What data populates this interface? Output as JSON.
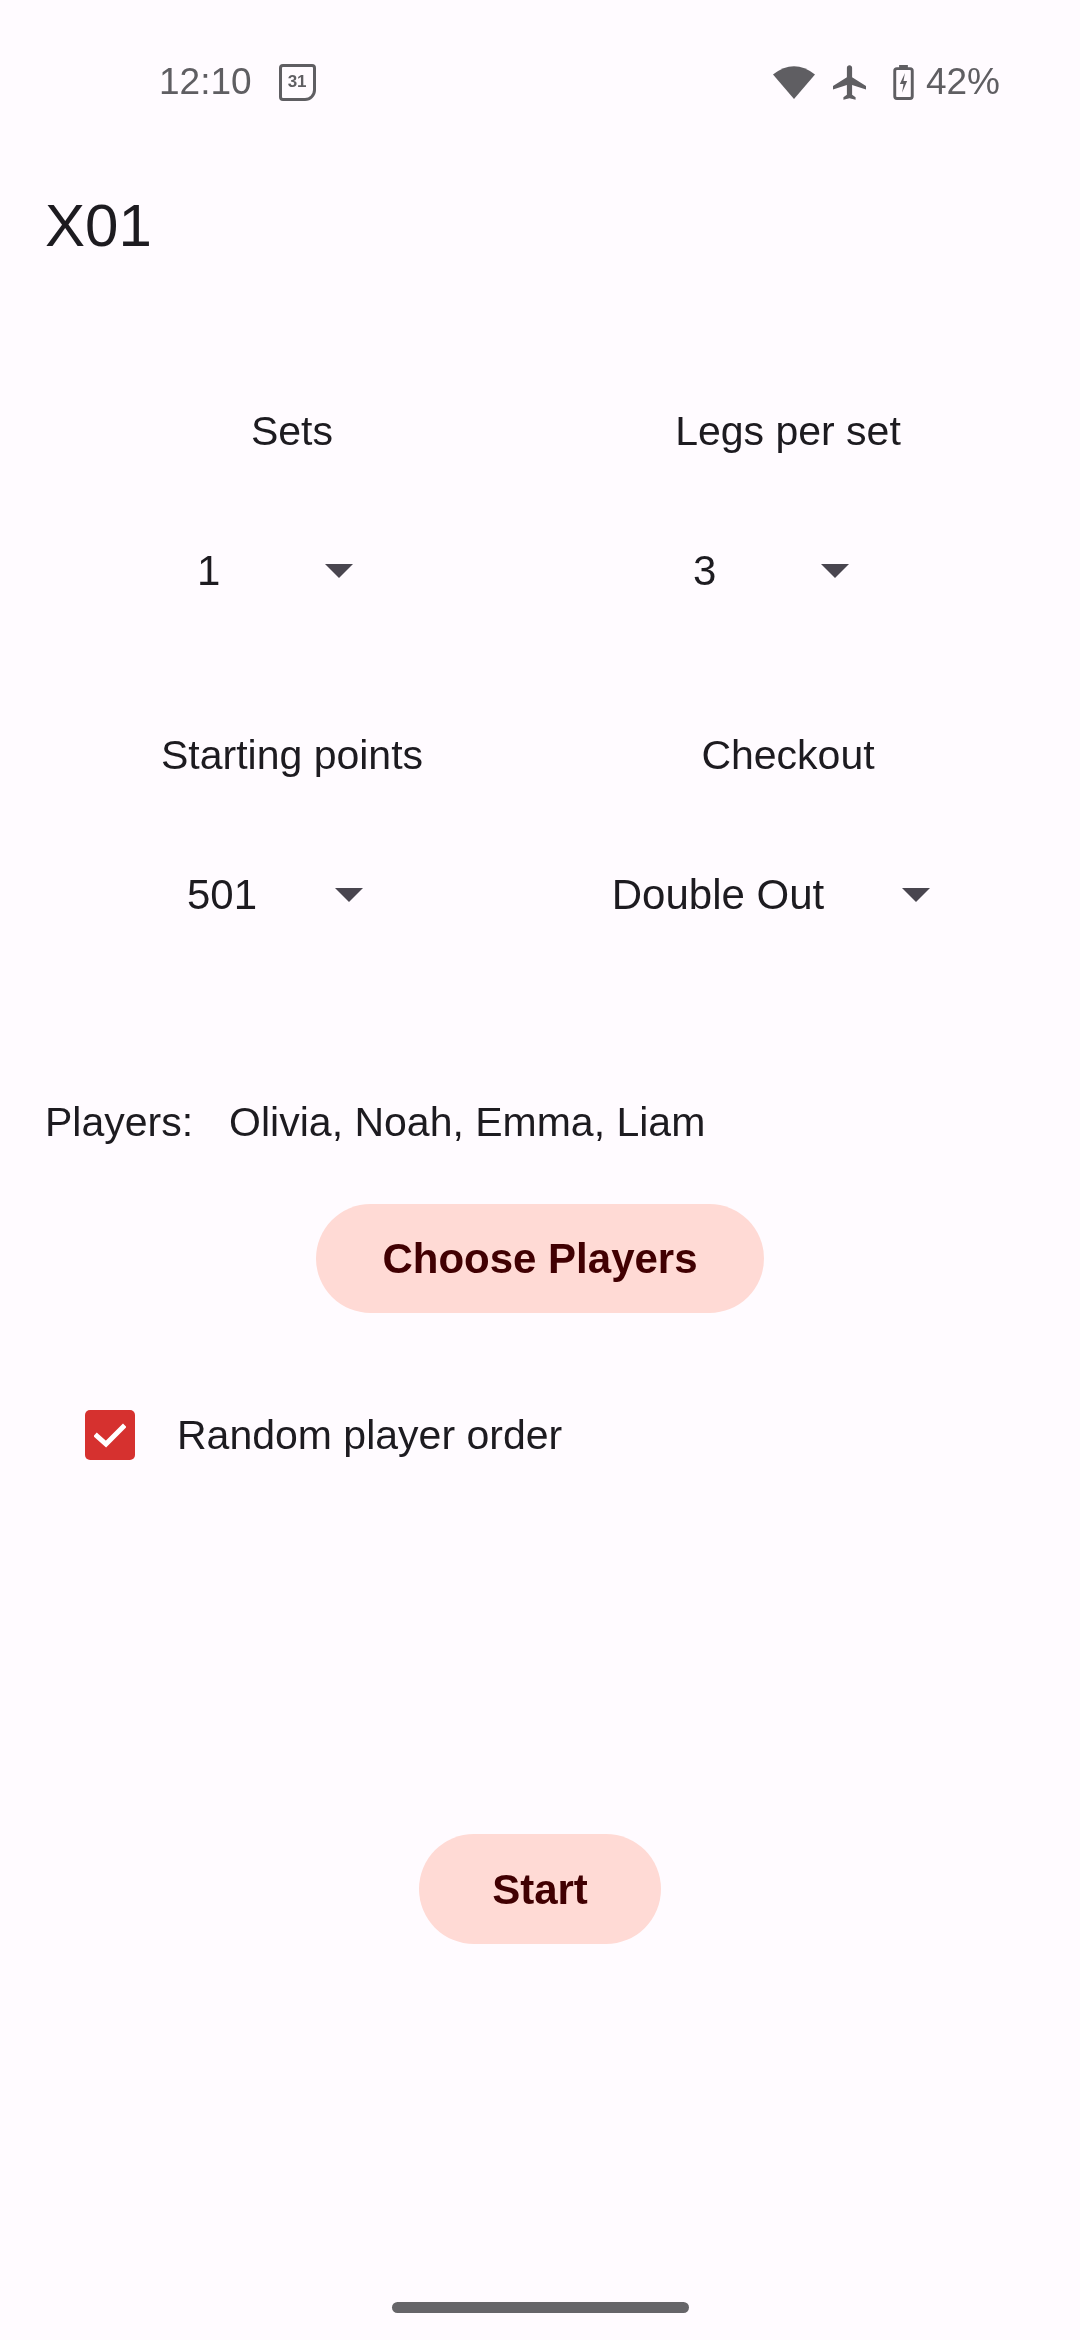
{
  "status_bar": {
    "time": "12:10",
    "calendar_day": "31",
    "battery": "42%"
  },
  "title": "X01",
  "settings": [
    {
      "label": "Sets",
      "value": "1"
    },
    {
      "label": "Legs per set",
      "value": "3"
    },
    {
      "label": "Starting points",
      "value": "501"
    },
    {
      "label": "Checkout",
      "value": "Double Out"
    }
  ],
  "players": {
    "label": "Players:",
    "names": "Olivia, Noah, Emma, Liam"
  },
  "choose_players_button": "Choose Players",
  "random_order": {
    "label": "Random player order",
    "checked": true
  },
  "start_button": "Start"
}
